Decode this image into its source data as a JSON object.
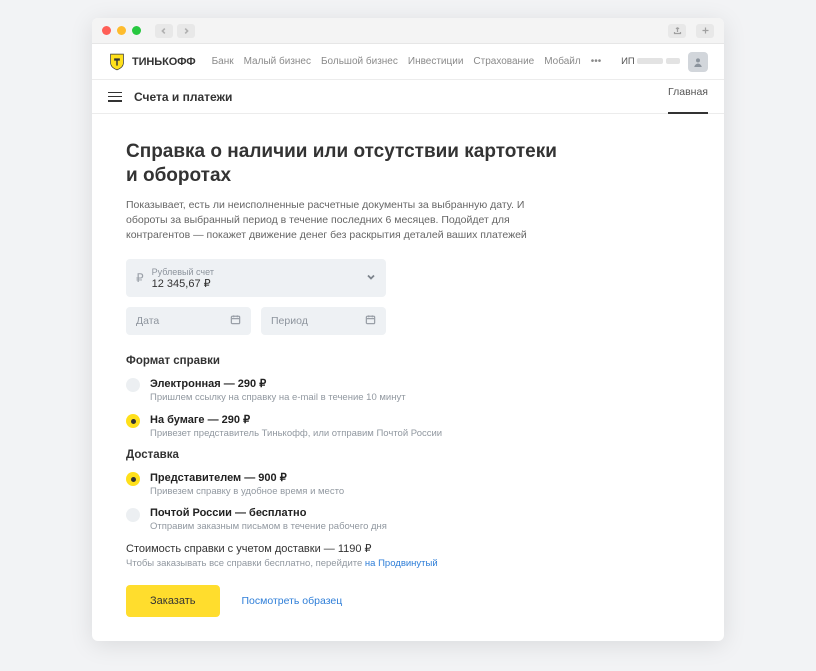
{
  "brand": "ТИНЬКОФФ",
  "nav": {
    "items": [
      "Банк",
      "Малый бизнес",
      "Большой бизнес",
      "Инвестиции",
      "Страхование",
      "Мобайл"
    ],
    "account_prefix": "ИП"
  },
  "subnav": {
    "title": "Счета и платежи",
    "crumb": "Главная"
  },
  "heading": "Справка о наличии или отсутствии картотеки и оборотах",
  "lead": "Показывает, есть ли неисполненные расчетные документы за выбранную дату. И обороты за выбранный период в течение последних 6 месяцев. Подойдет для контрагентов — покажет движение денег без раскрытия деталей ваших платежей",
  "account_select": {
    "label": "Рублевый счет",
    "value": "12 345,67 ₽"
  },
  "date_field": {
    "placeholder": "Дата"
  },
  "period_field": {
    "placeholder": "Период"
  },
  "format": {
    "heading": "Формат справки",
    "options": [
      {
        "label": "Электронная — 290 ₽",
        "hint": "Пришлем ссылку на справку на e-mail в течение 10 минут",
        "selected": false
      },
      {
        "label": "На бумаге — 290 ₽",
        "hint": "Привезет представитель Тинькофф, или отправим Почтой России",
        "selected": true
      }
    ]
  },
  "delivery": {
    "heading": "Доставка",
    "options": [
      {
        "label": "Представителем — 900 ₽",
        "hint": "Привезем справку в удобное время и место",
        "selected": true
      },
      {
        "label": "Почтой России — бесплатно",
        "hint": "Отправим заказным письмом в течение рабочего дня",
        "selected": false
      }
    ]
  },
  "total": {
    "line": "Стоимость справки с учетом доставки — 1190 ₽",
    "sub_prefix": "Чтобы заказывать все справки бесплатно, перейдите ",
    "sub_link": "на Продвинутый"
  },
  "actions": {
    "order": "Заказать",
    "sample": "Посмотреть образец"
  }
}
